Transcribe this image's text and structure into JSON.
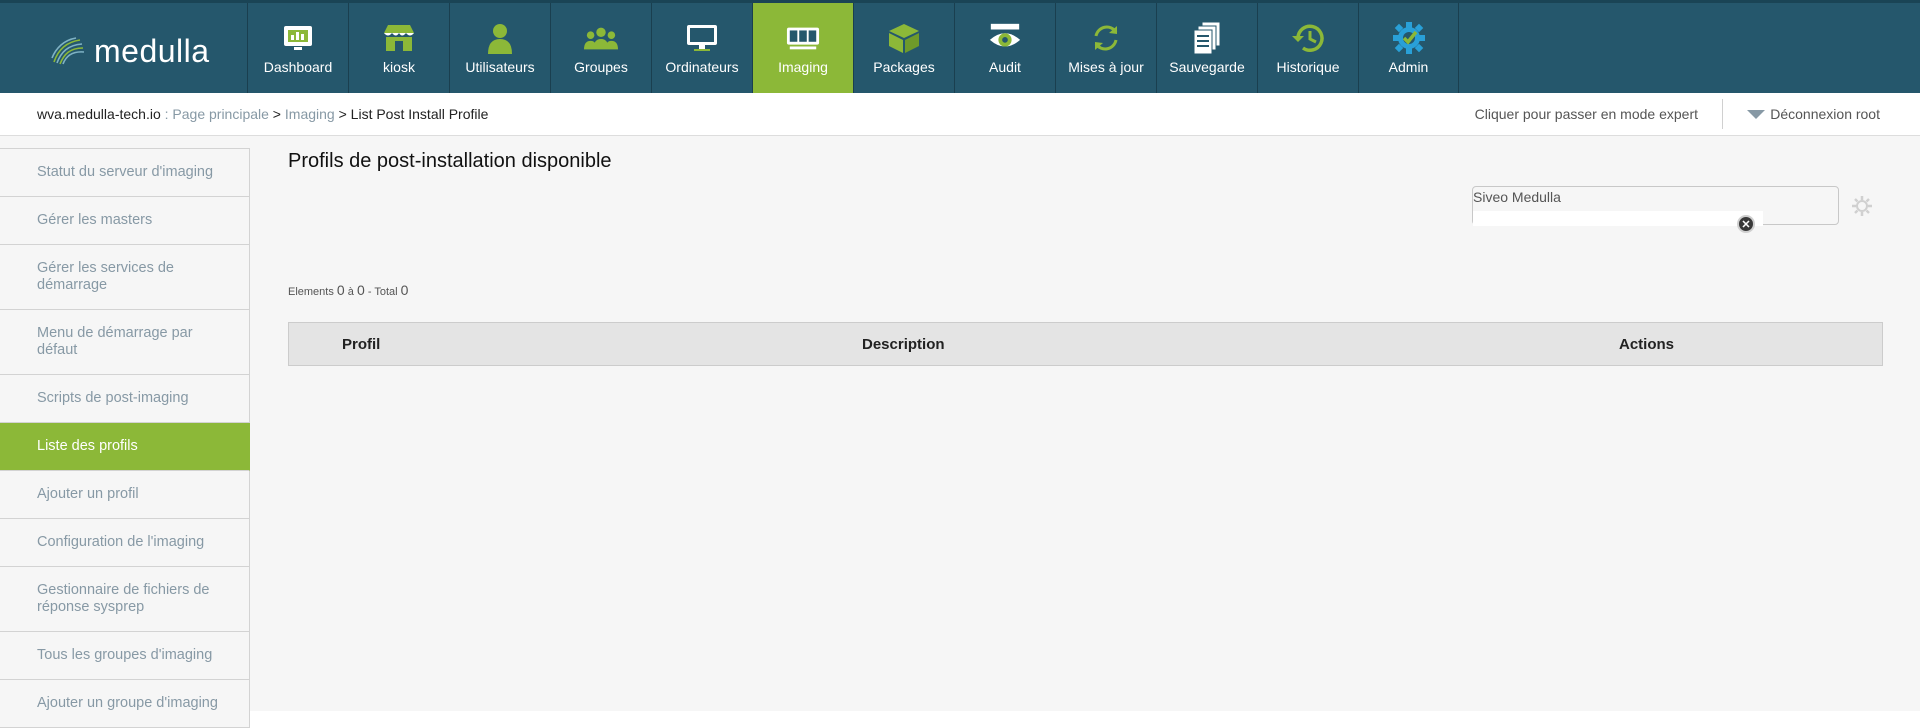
{
  "logo": {
    "text": "medulla"
  },
  "nav": [
    {
      "label": "Dashboard",
      "icon": "dashboard-icon"
    },
    {
      "label": "kiosk",
      "icon": "kiosk-icon"
    },
    {
      "label": "Utilisateurs",
      "icon": "user-icon"
    },
    {
      "label": "Groupes",
      "icon": "groups-icon"
    },
    {
      "label": "Ordinateurs",
      "icon": "computer-icon"
    },
    {
      "label": "Imaging",
      "icon": "imaging-icon",
      "active": true
    },
    {
      "label": "Packages",
      "icon": "packages-icon"
    },
    {
      "label": "Audit",
      "icon": "audit-eye-icon"
    },
    {
      "label": "Mises à jour",
      "icon": "update-icon"
    },
    {
      "label": "Sauvegarde",
      "icon": "backup-icon"
    },
    {
      "label": "Historique",
      "icon": "history-icon"
    },
    {
      "label": "Admin",
      "icon": "admin-gear-icon"
    }
  ],
  "breadcrumb": {
    "host": "wva.medulla-tech.io",
    "sep1": " : ",
    "home": "Page principale",
    "sep2": " > ",
    "section": "Imaging",
    "sep3": " > ",
    "current": "List Post Install Profile"
  },
  "header_right": {
    "expert": "Cliquer pour passer en mode expert",
    "logout": "Déconnexion root"
  },
  "sidebar": [
    {
      "label": "Statut du serveur d'imaging"
    },
    {
      "label": "Gérer les masters"
    },
    {
      "label": "Gérer les services de démarrage"
    },
    {
      "label": "Menu de démarrage par défaut"
    },
    {
      "label": "Scripts de post-imaging"
    },
    {
      "label": "Liste des profils",
      "active": true
    },
    {
      "label": "Ajouter un profil"
    },
    {
      "label": "Configuration de l'imaging"
    },
    {
      "label": "Gestionnaire de fichiers de réponse sysprep"
    },
    {
      "label": "Tous les groupes d'imaging"
    },
    {
      "label": "Ajouter un groupe d'imaging"
    }
  ],
  "main": {
    "title": "Profils de post-installation disponible",
    "filter_label": "Siveo Medulla",
    "filter_value": "",
    "count": {
      "prefix": "Elements",
      "from": "0",
      "sep": "à",
      "to": "0",
      "total_label": "- Total",
      "total": "0"
    },
    "columns": [
      "Profil",
      "Description",
      "Actions"
    ]
  },
  "colors": {
    "nav_bg": "#25576c",
    "accent": "#8cb838",
    "link": "#8799a5"
  }
}
